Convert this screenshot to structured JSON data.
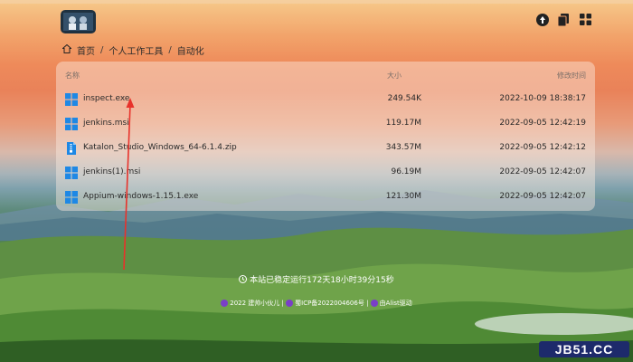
{
  "breadcrumb": {
    "home": "首页",
    "items": [
      "个人工作工具",
      "自动化"
    ],
    "separator": "/"
  },
  "table": {
    "headers": {
      "name": "名称",
      "size": "大小",
      "date": "修改时间"
    },
    "rows": [
      {
        "name": "inspect.exe",
        "size": "249.54K",
        "date": "2022-10-09 18:38:17",
        "icon": "windows-icon"
      },
      {
        "name": "jenkins.msi",
        "size": "119.17M",
        "date": "2022-09-05 12:42:19",
        "icon": "windows-icon"
      },
      {
        "name": "Katalon_Studio_Windows_64-6.1.4.zip",
        "size": "343.57M",
        "date": "2022-09-05 12:42:12",
        "icon": "zip-file-icon"
      },
      {
        "name": "jenkins(1).msi",
        "size": "96.19M",
        "date": "2022-09-05 12:42:07",
        "icon": "windows-icon"
      },
      {
        "name": "Appium-windows-1.15.1.exe",
        "size": "121.30M",
        "date": "2022-09-05 12:42:07",
        "icon": "windows-icon"
      }
    ]
  },
  "footer": {
    "uptime": "本站已稳定运行172天18小时39分15秒",
    "owner": "2022 建帅小伙儿",
    "icp": "蜀ICP备2022004606号",
    "powered_by": "由Alist驱动",
    "sep": "|"
  },
  "watermark": "JB51.CC",
  "colors": {
    "accent_blue": "#1e88e5",
    "footer_dot": "#7a3fc7",
    "watermark_bg": "#1d2a6b"
  },
  "top_icons": [
    "upload-icon",
    "copy-icon",
    "grid-icon"
  ]
}
